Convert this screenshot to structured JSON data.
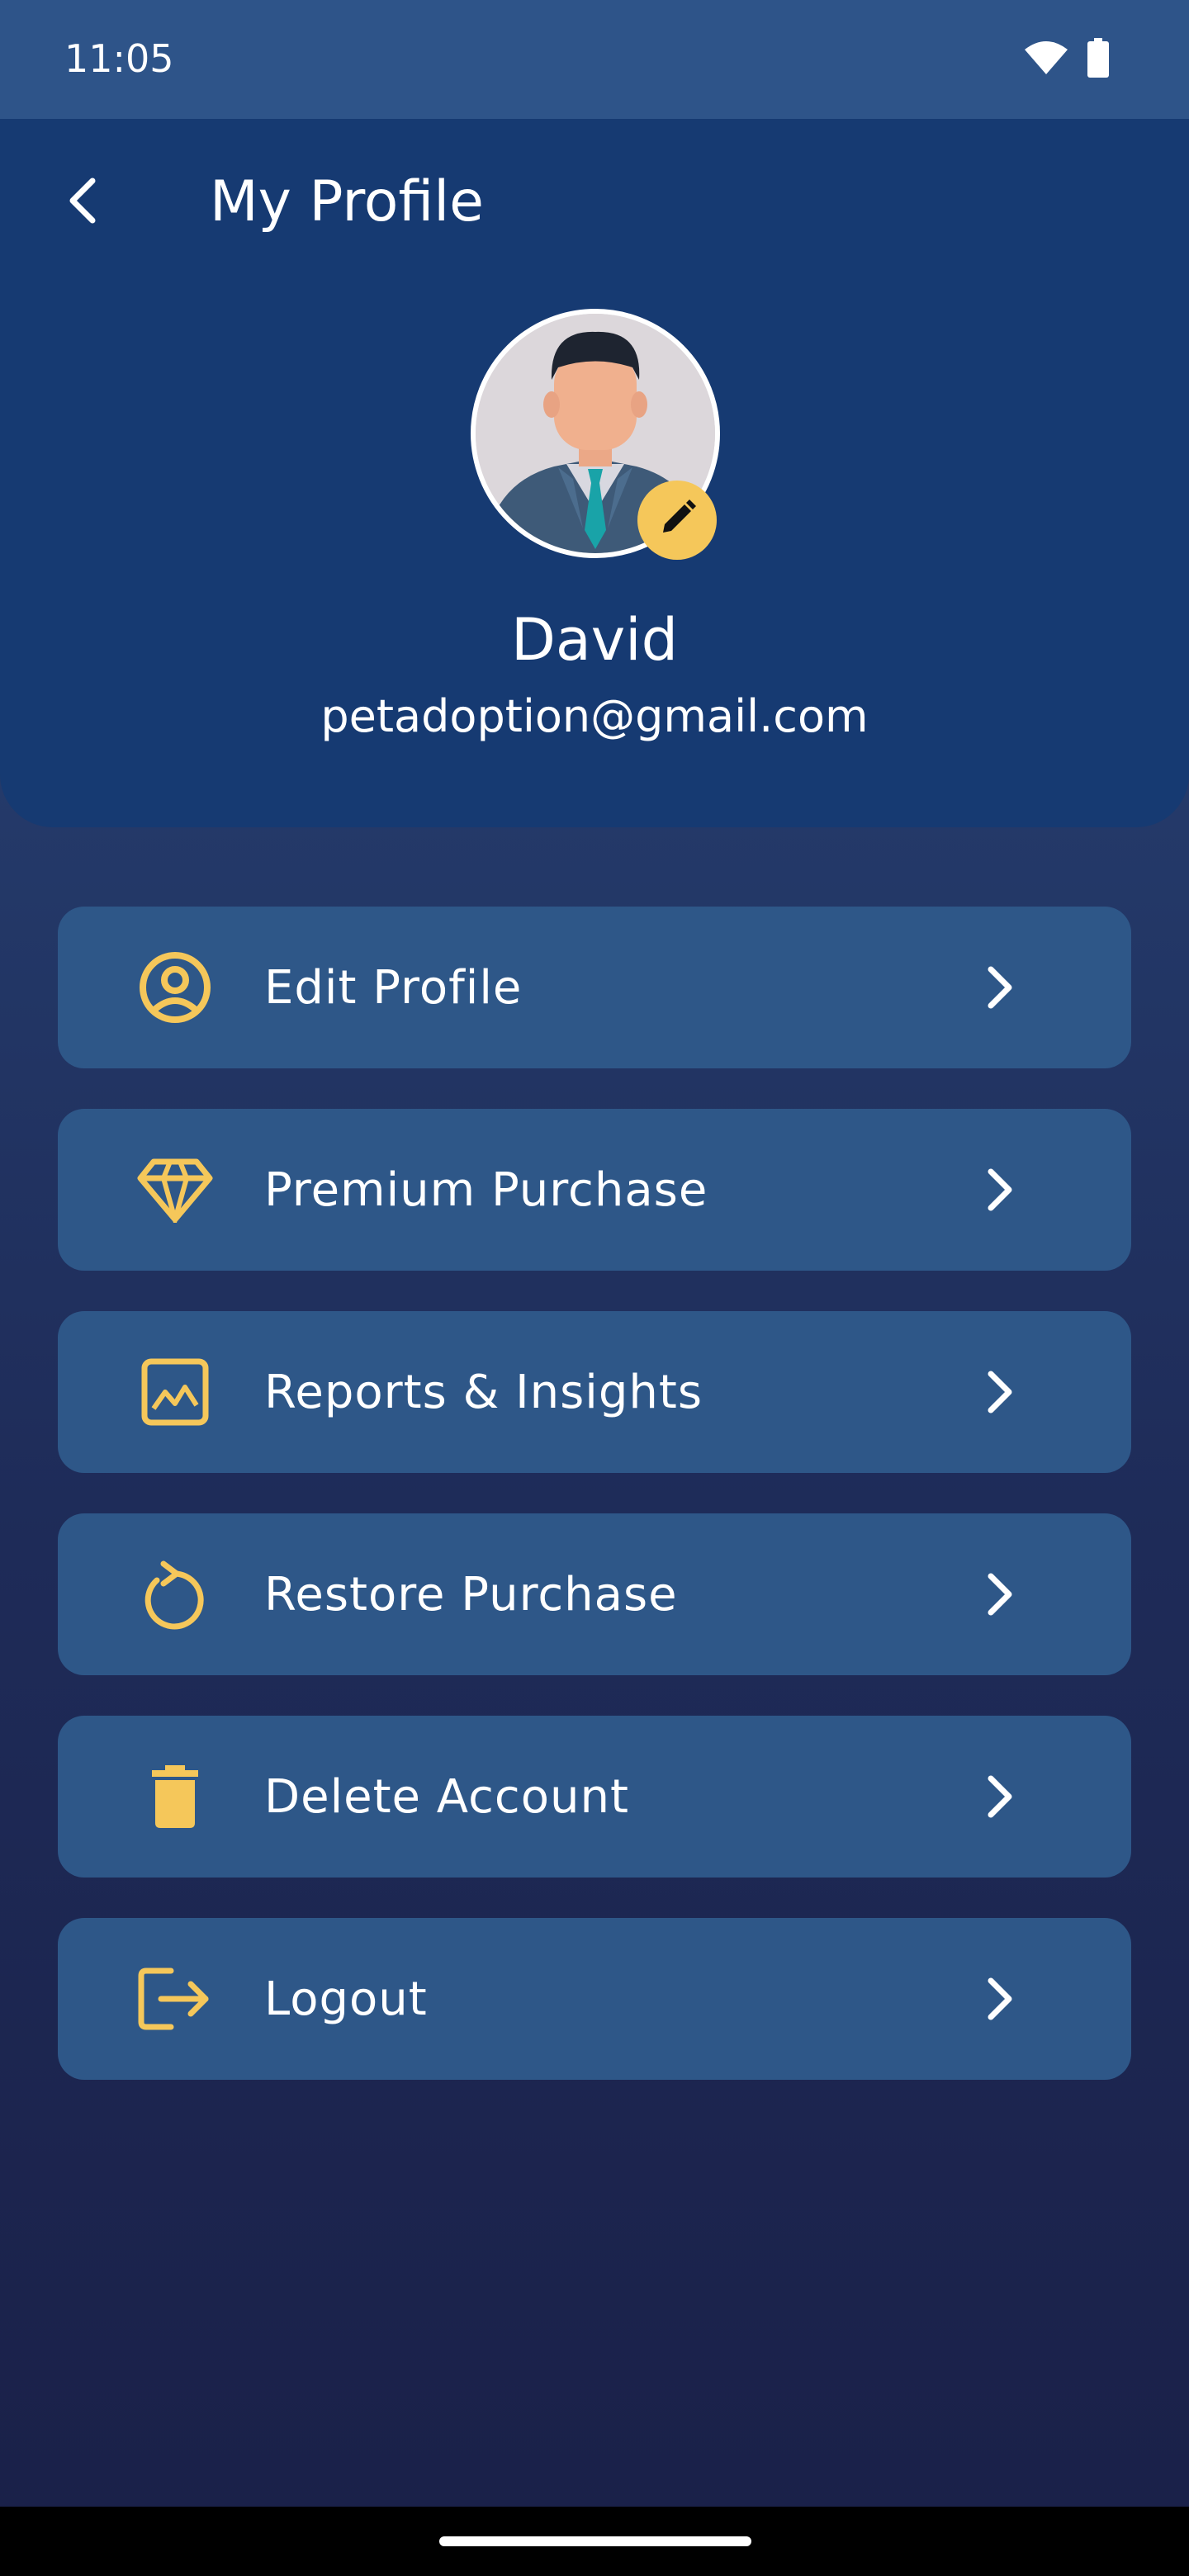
{
  "status_bar": {
    "time": "11:05",
    "wifi_icon": "wifi-icon",
    "battery_icon": "battery-icon"
  },
  "header": {
    "back_icon": "chevron-left-icon",
    "title": "My Profile"
  },
  "profile": {
    "avatar_icon": "user-avatar",
    "edit_icon": "pencil-icon",
    "name": "David",
    "email": "petadoption@gmail.com"
  },
  "menu": {
    "items": [
      {
        "label": "Edit Profile",
        "icon": "account-circle-icon"
      },
      {
        "label": "Premium Purchase",
        "icon": "diamond-icon"
      },
      {
        "label": "Reports & Insights",
        "icon": "image-chart-icon"
      },
      {
        "label": "Restore Purchase",
        "icon": "restore-icon"
      },
      {
        "label": "Delete Account",
        "icon": "trash-icon"
      },
      {
        "label": "Logout",
        "icon": "logout-icon"
      }
    ],
    "chevron_icon": "chevron-right-icon"
  },
  "colors": {
    "accent": "#f5c75a",
    "header_bg": "#163a72",
    "card_bg": "#2e5788",
    "status_bar_bg": "#2e5489"
  }
}
